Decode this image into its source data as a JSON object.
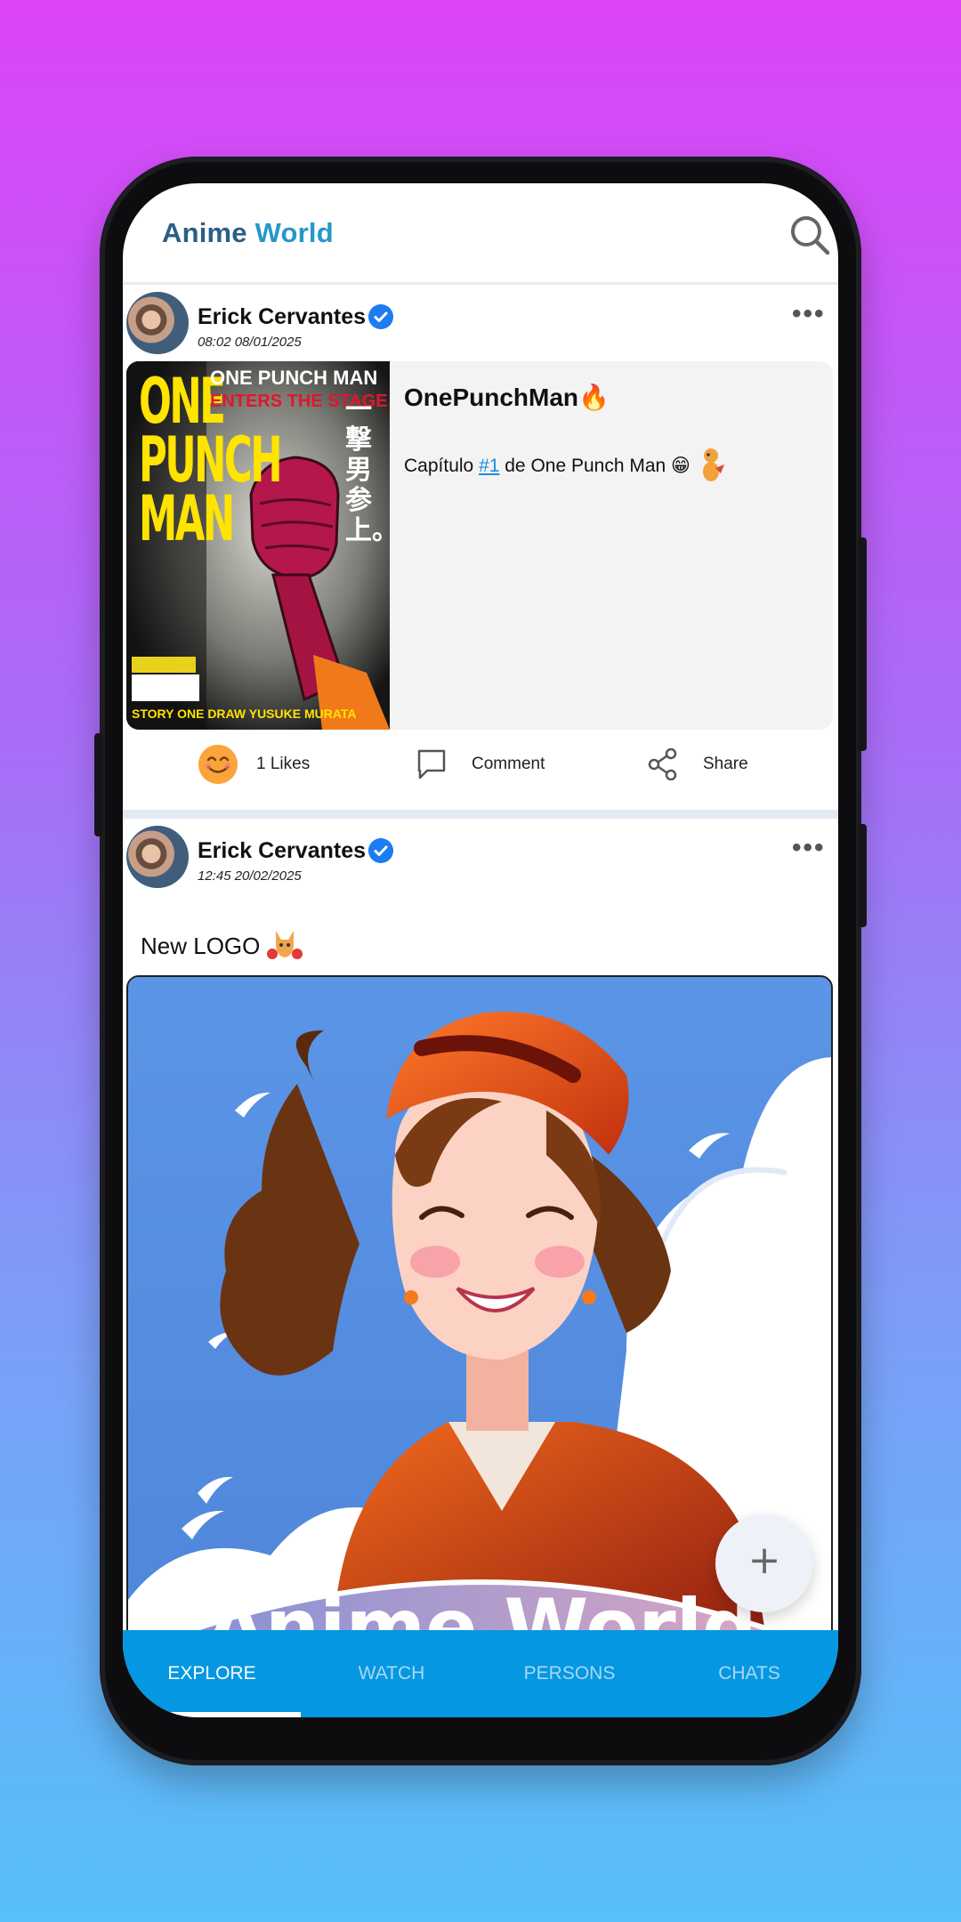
{
  "app": {
    "brand_part1": "Anime",
    "brand_part2": "World"
  },
  "colors": {
    "accent": "#0597e2",
    "brand_dark": "#2a5f86",
    "brand_light": "#2598c8",
    "verified": "#1d7cf2",
    "link": "#1a8fdf"
  },
  "icons": {
    "search": "search-icon",
    "more": "more-horizontal-icon",
    "verified": "verified-check-icon",
    "like": "smiley-face-icon",
    "comment": "comment-bubble-icon",
    "share": "share-nodes-icon",
    "add": "plus-icon"
  },
  "posts": [
    {
      "author": "Erick Cervantes",
      "time": "08:02 08/01/2025",
      "card_title": "OnePunchMan🔥",
      "text_before": "Capítulo ",
      "tag": "#1",
      "text_after": " de One Punch Man 😁",
      "cover": {
        "title": "ONE PUNCH MAN",
        "tagline": "ONE PUNCH MAN",
        "tagline2": "ENTERS THE STAGE",
        "kanji": "一撃男参上。",
        "credits": "STORY ONE  DRAW YUSUKE MURATA"
      },
      "likes_label": "1 Likes",
      "comment_label": "Comment",
      "share_label": "Share"
    },
    {
      "author": "Erick Cervantes",
      "time": "12:45 20/02/2025",
      "text": "New LOGO"
    }
  ],
  "poster_banner_text": "Anime World",
  "nav": {
    "tabs": [
      "EXPLORE",
      "WATCH",
      "PERSONS",
      "CHATS"
    ],
    "active_index": 0
  }
}
